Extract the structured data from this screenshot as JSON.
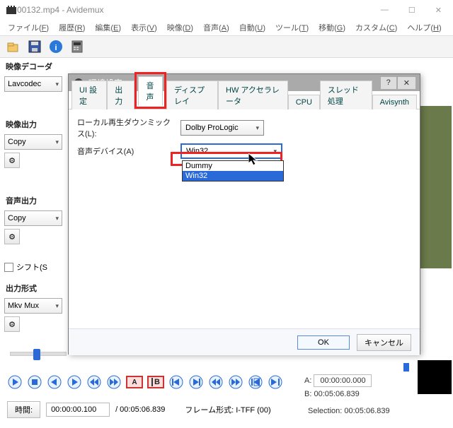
{
  "window": {
    "title": "00132.mp4 - Avidemux"
  },
  "menubar": [
    {
      "label": "ファイル",
      "mnemonic": "F"
    },
    {
      "label": "履歴",
      "mnemonic": "R"
    },
    {
      "label": "編集",
      "mnemonic": "E"
    },
    {
      "label": "表示",
      "mnemonic": "V"
    },
    {
      "label": "映像",
      "mnemonic": "D"
    },
    {
      "label": "音声",
      "mnemonic": "A"
    },
    {
      "label": "自動",
      "mnemonic": "U"
    },
    {
      "label": "ツール",
      "mnemonic": "T"
    },
    {
      "label": "移動",
      "mnemonic": "G"
    },
    {
      "label": "カスタム",
      "mnemonic": "C"
    },
    {
      "label": "ヘルプ",
      "mnemonic": "H"
    }
  ],
  "left": {
    "decoder_label": "映像デコーダ",
    "decoder_value": "Lavcodec",
    "video_out_label": "映像出力",
    "video_out_value": "Copy",
    "audio_out_label": "音声出力",
    "audio_out_value": "Copy",
    "shift_label": "シフト(S",
    "output_fmt_label": "出力形式",
    "output_fmt_value": "Mkv Mux"
  },
  "dialog": {
    "title": "環境設定",
    "tabs": [
      "UI 設定",
      "出力",
      "音声",
      "ディスプレイ",
      "HW アクセラレータ",
      "CPU",
      "スレッド処理",
      "Avisynth"
    ],
    "active_tab_index": 2,
    "downmix_label": "ローカル再生ダウンミックス(L):",
    "downmix_value": "Dolby ProLogic",
    "device_label": "音声デバイス(A)",
    "device_value": "Win32",
    "device_options": [
      "Dummy",
      "Win32"
    ],
    "device_selected_index": 1,
    "ok": "OK",
    "cancel": "キャンセル"
  },
  "playback": {
    "marker_a": "A",
    "marker_b": "B"
  },
  "info": {
    "a_label": "A:",
    "a_value": "00:00:00.000",
    "b_label": "B:",
    "b_value": "00:05:06.839",
    "selection_label": "Selection:",
    "selection_value": "00:05:06.839"
  },
  "bottom": {
    "time_btn": "時間:",
    "time_value": "00:00:00.100",
    "duration": "/ 00:05:06.839",
    "frame_type": "フレーム形式: I-TFF (00)"
  }
}
